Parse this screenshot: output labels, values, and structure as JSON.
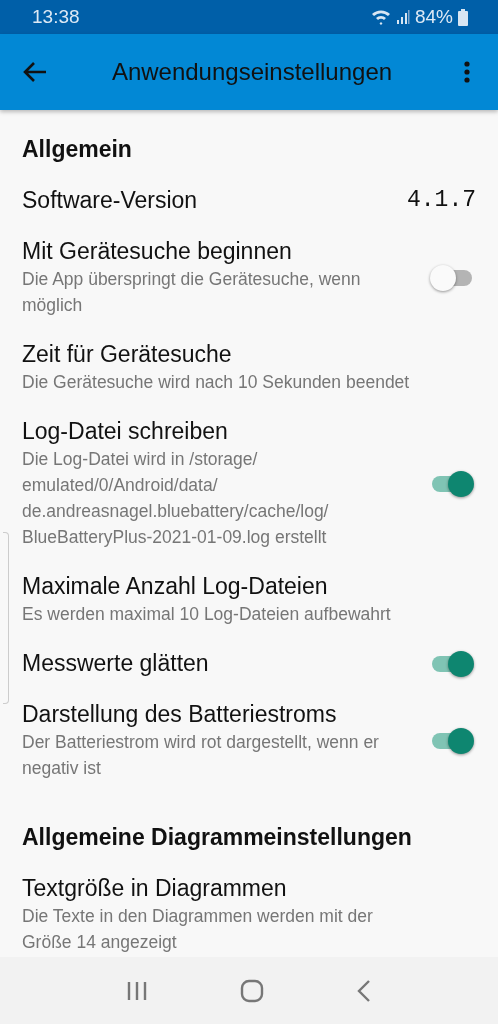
{
  "status_bar": {
    "time": "13:38",
    "battery": "84%"
  },
  "app_bar": {
    "title": "Anwendungseinstellungen"
  },
  "settings": [
    {
      "kind": "header",
      "title": "Allgemein"
    },
    {
      "kind": "value",
      "title": "Software-Version",
      "value": "4.1.7"
    },
    {
      "kind": "toggle",
      "title": "Mit Gerätesuche beginnen",
      "summary": "Die App überspringt die Gerätesuche, wenn möglich",
      "on": false
    },
    {
      "kind": "text",
      "title": "Zeit für Gerätesuche",
      "summary": "Die Gerätesuche wird nach 10 Sekunden beendet"
    },
    {
      "kind": "toggle",
      "title": "Log-Datei schreiben",
      "summary": "Die Log-Datei wird in /storage/ emulated/0/Android/data/ de.andreasnagel.bluebattery/cache/log/ BlueBatteryPlus-2021-01-09.log erstellt",
      "on": true
    },
    {
      "kind": "text",
      "title": "Maximale Anzahl Log-Dateien",
      "summary": "Es werden maximal 10 Log-Dateien aufbewahrt"
    },
    {
      "kind": "toggle",
      "title": "Messwerte glätten",
      "on": true
    },
    {
      "kind": "toggle",
      "title": "Darstellung des Batteriestroms",
      "summary": "Der Batteriestrom wird rot dargestellt, wenn er negativ ist",
      "on": true
    },
    {
      "kind": "header",
      "title": "Allgemeine Diagrammeinstellungen"
    },
    {
      "kind": "text",
      "title": "Textgröße in Diagrammen",
      "summary": "Die Texte in den Diagrammen werden mit der Größe 14 angezeigt"
    }
  ]
}
